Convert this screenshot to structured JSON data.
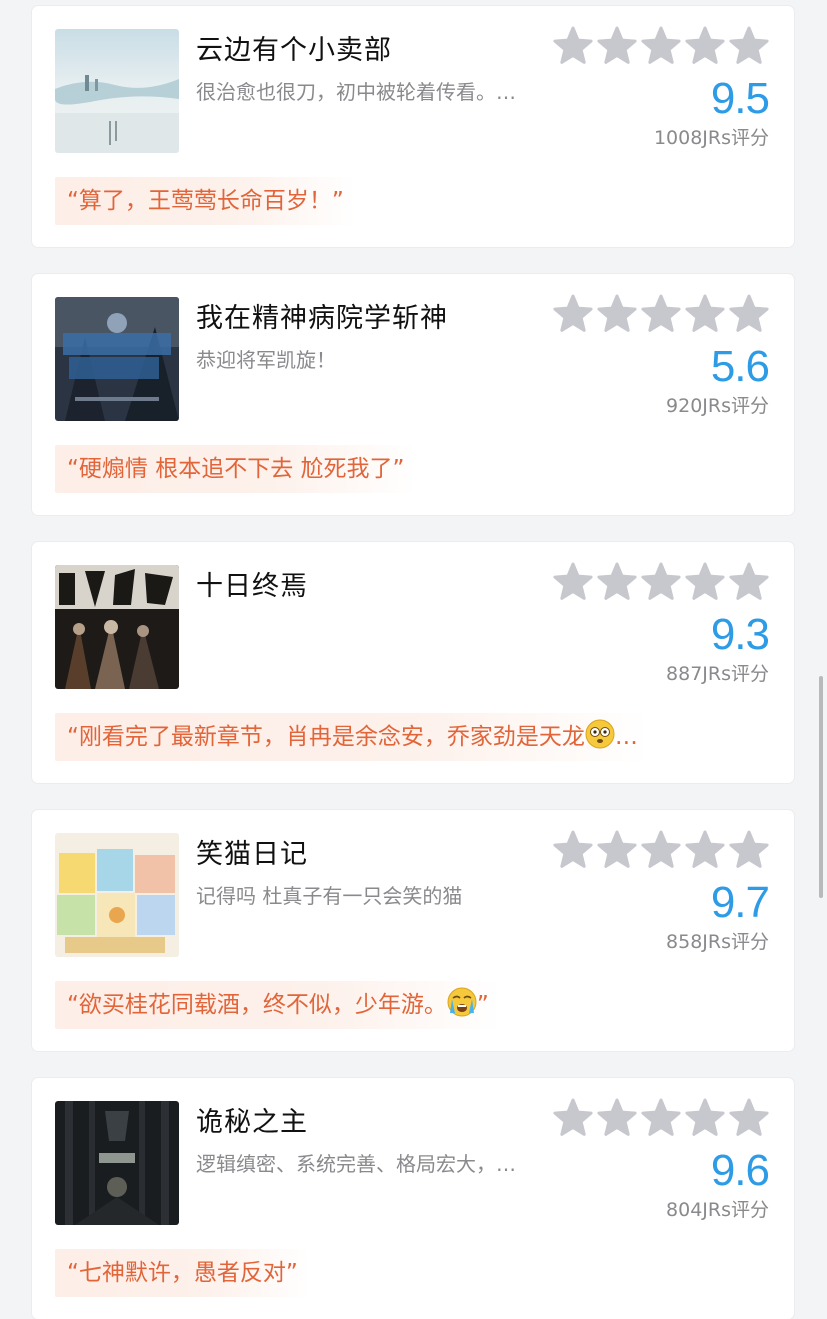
{
  "accent_color": "#2d9be6",
  "quote_color": "#e2653a",
  "star_color": "#c7c8cd",
  "items": [
    {
      "title": "云边有个小卖部",
      "desc": "很治愈也很刀，初中被轮着传看。…",
      "score": "9.5",
      "count": "1008JRs评分",
      "quote": "“算了，王莺莺长命百岁！”",
      "cover_icon": "book-cover-sky-icon"
    },
    {
      "title": "我在精神病院学斩神",
      "desc": "恭迎将军凯旋！",
      "score": "5.6",
      "count": "920JRs评分",
      "quote": "“硬煽情 根本追不下去 尬死我了”",
      "cover_icon": "anime-poster-icon"
    },
    {
      "title": "十日终焉",
      "desc": "",
      "score": "9.3",
      "count": "887JRs评分",
      "quote": "“刚看完了最新章节，肖冉是余念安，乔家劲是天龙",
      "quote_suffix": "…",
      "quote_emoji": "dizzy-face-emoji-icon",
      "cover_icon": "dark-poster-icon"
    },
    {
      "title": "笑猫日记",
      "desc": "记得吗 杜真子有一只会笑的猫",
      "score": "9.7",
      "count": "858JRs评分",
      "quote": "“欲买桂花同载酒，终不似，少年游。",
      "quote_suffix": "”",
      "quote_emoji": "crying-face-emoji-icon",
      "cover_icon": "book-stack-icon"
    },
    {
      "title": "诡秘之主",
      "desc": "逻辑缜密、系统完善、格局宏大，…",
      "score": "9.6",
      "count": "804JRs评分",
      "quote": "“七神默许，愚者反对”",
      "cover_icon": "gothic-poster-icon"
    }
  ]
}
